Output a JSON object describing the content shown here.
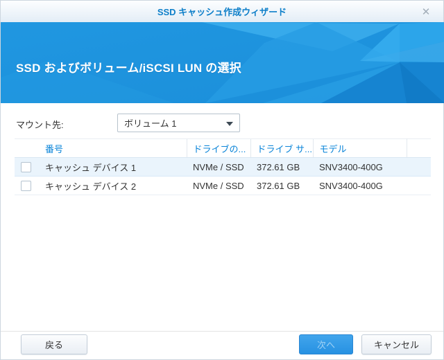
{
  "window": {
    "title": "SSD キャッシュ作成ウィザード"
  },
  "icons": {
    "close": "✕"
  },
  "banner": {
    "title": "SSD およびボリューム/iSCSI LUN の選択"
  },
  "form": {
    "mount_label": "マウント先:",
    "mount_value": "ボリューム 1"
  },
  "table": {
    "columns": [
      "番号",
      "ドライブの...",
      "ドライブ サ...",
      "モデル"
    ],
    "rows": [
      {
        "name": "キャッシュ デバイス 1",
        "type": "NVMe / SSD",
        "size": "372.61 GB",
        "model": "SNV3400-400G",
        "checked": false,
        "highlighted": true
      },
      {
        "name": "キャッシュ デバイス 2",
        "type": "NVMe / SSD",
        "size": "372.61 GB",
        "model": "SNV3400-400G",
        "checked": false,
        "highlighted": false
      }
    ]
  },
  "footer": {
    "back_label": "戻る",
    "next_label": "次へ",
    "cancel_label": "キャンセル"
  },
  "colors": {
    "accent_blue": "#1e95df",
    "titlebar_text": "#0e7fc9",
    "table_header_text": "#0a84d8",
    "row_highlight": "#eaf4fc",
    "next_button": "#2e9be6"
  }
}
